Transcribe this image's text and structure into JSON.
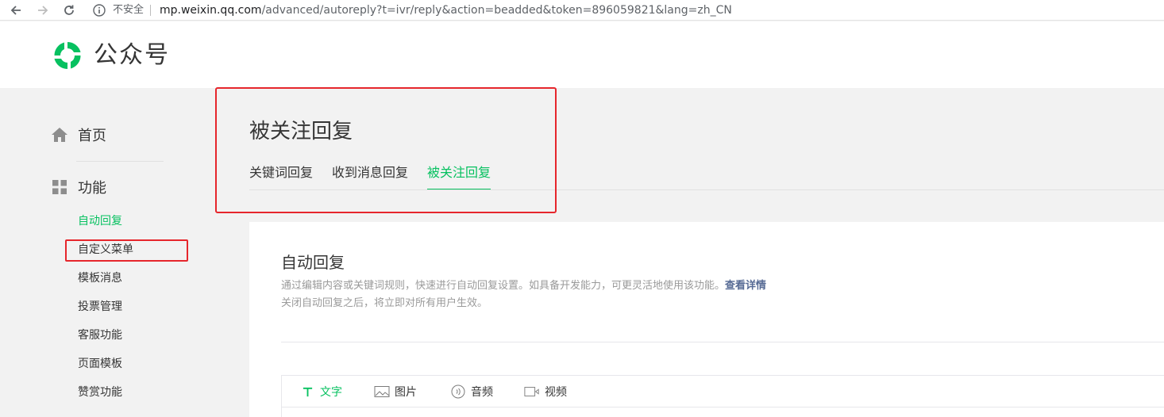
{
  "browser": {
    "security_label": "不安全",
    "url_host": "mp.weixin.qq.com",
    "url_path": "/advanced/autoreply?t=ivr/reply&action=beadded&token=896059821&lang=zh_CN"
  },
  "header": {
    "brand": "公众号"
  },
  "sidebar": {
    "home_label": "首页",
    "function_label": "功能",
    "items": [
      {
        "label": "自动回复",
        "active": true
      },
      {
        "label": "自定义菜单",
        "active": false
      },
      {
        "label": "模板消息",
        "active": false
      },
      {
        "label": "投票管理",
        "active": false
      },
      {
        "label": "客服功能",
        "active": false
      },
      {
        "label": "页面模板",
        "active": false
      },
      {
        "label": "赞赏功能",
        "active": false
      }
    ]
  },
  "page": {
    "title": "被关注回复",
    "tabs": [
      {
        "label": "关键词回复",
        "active": false
      },
      {
        "label": "收到消息回复",
        "active": false
      },
      {
        "label": "被关注回复",
        "active": true
      }
    ]
  },
  "panel": {
    "title": "自动回复",
    "desc_line1": "通过编辑内容或关键词规则，快速进行自动回复设置。如具备开发能力，可更灵活地使用该功能。",
    "desc_link": "查看详情",
    "desc_line2": "关闭自动回复之后，将立即对所有用户生效。",
    "editor_tabs": [
      {
        "label": "文字",
        "icon": "text-icon",
        "active": true
      },
      {
        "label": "图片",
        "icon": "image-icon",
        "active": false
      },
      {
        "label": "音频",
        "icon": "audio-icon",
        "active": false
      },
      {
        "label": "视频",
        "icon": "video-icon",
        "active": false
      }
    ]
  },
  "colors": {
    "accent": "#07c160",
    "highlight_box": "#e6262c",
    "link": "#576b95"
  }
}
